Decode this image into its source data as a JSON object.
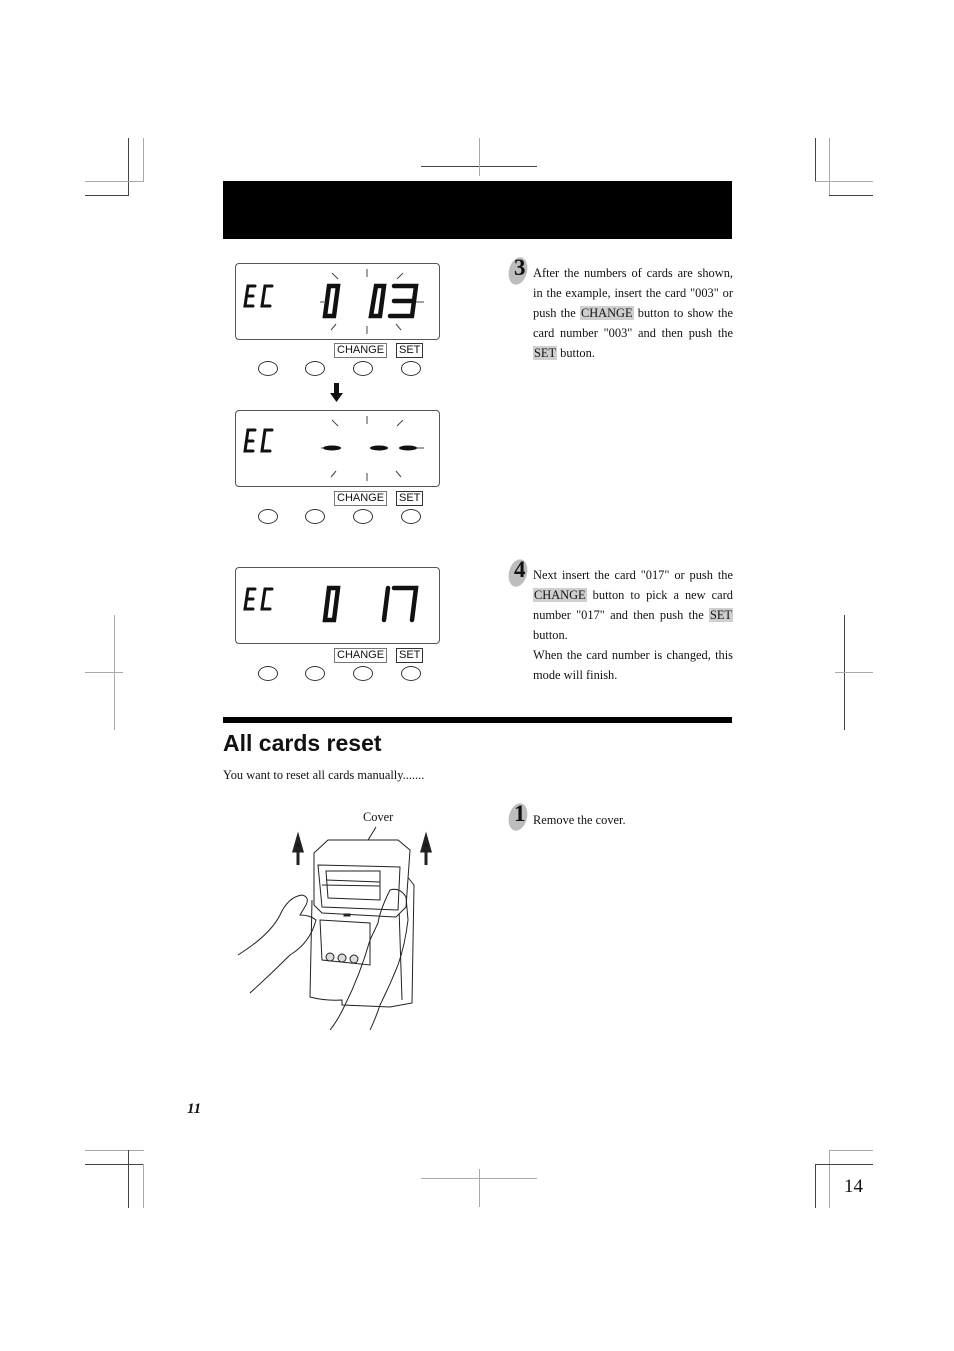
{
  "displays": [
    {
      "prefix": "EC",
      "value": "0 03",
      "state": "blinking",
      "keys": {
        "change": "CHANGE",
        "set": "SET"
      }
    },
    {
      "prefix": "EC",
      "value": "- --",
      "state": "blinking",
      "keys": {
        "change": "CHANGE",
        "set": "SET"
      }
    },
    {
      "prefix": "EC",
      "value": "0 17",
      "state": "static",
      "keys": {
        "change": "CHANGE",
        "set": "SET"
      }
    }
  ],
  "steps": {
    "s3": {
      "number": "3",
      "t1": "After the numbers of cards are shown, in the example, insert the card \"003\" or push the ",
      "b1": "CHANGE",
      "t2": " button to show the card number \"003\" and then push the ",
      "b2": "SET",
      "t3": " button."
    },
    "s4": {
      "number": "4",
      "t1": "Next insert the card \"017\" or push the ",
      "b1": "CHANGE",
      "t2": " button to pick a new card number \"017\" and then push the ",
      "b2": "SET",
      "t3": " button.",
      "t4": "When the card number is changed, this mode will finish."
    },
    "s1": {
      "number": "1",
      "text": "Remove the cover."
    }
  },
  "section": {
    "title": "All cards reset",
    "intro": "You want to reset all cards manually......."
  },
  "illustration": {
    "label": "Cover"
  },
  "page": {
    "left_number": "11",
    "right_number": "14"
  }
}
